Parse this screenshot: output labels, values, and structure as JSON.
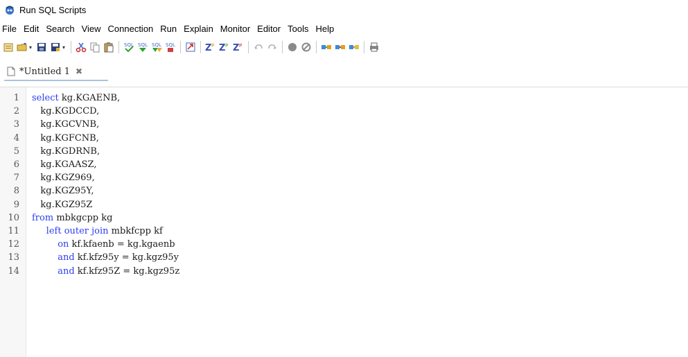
{
  "window": {
    "title": "Run SQL Scripts"
  },
  "menu": [
    "File",
    "Edit",
    "Search",
    "View",
    "Connection",
    "Run",
    "Explain",
    "Monitor",
    "Editor",
    "Tools",
    "Help"
  ],
  "toolbar": {
    "buttons": [
      "new-icon",
      "open-icon",
      "save-icon",
      "save-as-icon",
      "cut-icon",
      "copy-icon",
      "paste-icon",
      "sql-check-icon",
      "run-sql-icon",
      "run-sql-selected-icon",
      "run-sql-to-cursor-icon",
      "export-icon",
      "explain-icon",
      "explain-selected-icon",
      "explain-cursor-icon",
      "undo-icon",
      "redo-icon",
      "stop-icon",
      "cancel-icon",
      "connect-icon",
      "disconnect-icon",
      "reconnect-icon",
      "print-icon"
    ]
  },
  "tab": {
    "label": "*Untitled 1",
    "close": "✖"
  },
  "editor": {
    "lines": [
      {
        "num": "1",
        "indent": "",
        "kw": "select",
        "text": " kg.KGAENB,"
      },
      {
        "num": "2",
        "indent": "   ",
        "kw": "",
        "text": "kg.KGDCCD,"
      },
      {
        "num": "3",
        "indent": "   ",
        "kw": "",
        "text": "kg.KGCVNB,"
      },
      {
        "num": "4",
        "indent": "   ",
        "kw": "",
        "text": "kg.KGFCNB,"
      },
      {
        "num": "5",
        "indent": "   ",
        "kw": "",
        "text": "kg.KGDRNB,"
      },
      {
        "num": "6",
        "indent": "   ",
        "kw": "",
        "text": "kg.KGAASZ,"
      },
      {
        "num": "7",
        "indent": "   ",
        "kw": "",
        "text": "kg.KGZ969,"
      },
      {
        "num": "8",
        "indent": "   ",
        "kw": "",
        "text": "kg.KGZ95Y,"
      },
      {
        "num": "9",
        "indent": "   ",
        "kw": "",
        "text": "kg.KGZ95Z"
      },
      {
        "num": "10",
        "indent": "",
        "kw": "from",
        "text": " mbkgcpp kg"
      },
      {
        "num": "11",
        "indent": "     ",
        "kw": "left outer join",
        "text": " mbkfcpp kf"
      },
      {
        "num": "12",
        "indent": "         ",
        "kw": "on",
        "text": " kf.kfaenb = kg.kgaenb"
      },
      {
        "num": "13",
        "indent": "         ",
        "kw": "and",
        "text": " kf.kfz95y = kg.kgz95y"
      },
      {
        "num": "14",
        "indent": "         ",
        "kw": "and",
        "text": " kf.kfz95Z = kg.kgz95z"
      }
    ]
  },
  "colors": {
    "keyword": "#2b3df0",
    "gutter": "#f7f7f7"
  }
}
